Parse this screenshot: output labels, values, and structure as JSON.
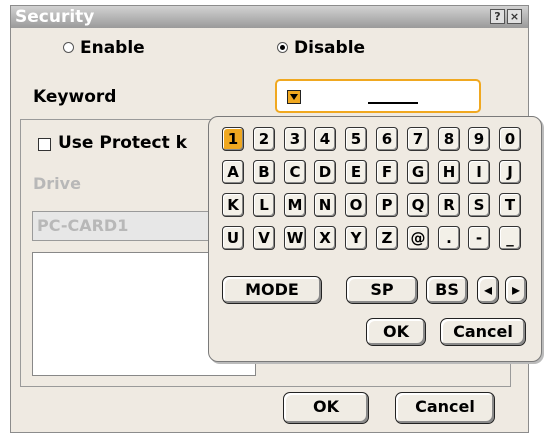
{
  "window": {
    "title": "Security",
    "help_glyph": "?",
    "close_glyph": "×"
  },
  "mode": {
    "enable_label": "Enable",
    "disable_label": "Disable",
    "selected": "Disable"
  },
  "keyword": {
    "label": "Keyword",
    "value": "",
    "accent_color": "#f0a820"
  },
  "protect": {
    "checkbox_label": "Use Protect key",
    "visible_label_fragment": "Use Protect k",
    "checked": false,
    "drive_label": "Drive",
    "drive_value": "PC-CARD1"
  },
  "dialog_buttons": {
    "ok": "OK",
    "cancel": "Cancel"
  },
  "keyboard": {
    "rows": [
      [
        "1",
        "2",
        "3",
        "4",
        "5",
        "6",
        "7",
        "8",
        "9",
        "0"
      ],
      [
        "A",
        "B",
        "C",
        "D",
        "E",
        "F",
        "G",
        "H",
        "I",
        "J"
      ],
      [
        "K",
        "L",
        "M",
        "N",
        "O",
        "P",
        "Q",
        "R",
        "S",
        "T"
      ],
      [
        "U",
        "V",
        "W",
        "X",
        "Y",
        "Z",
        "@",
        ".",
        "-",
        "_"
      ]
    ],
    "active_key": "1",
    "mode_label": "MODE",
    "space_label": "SP",
    "backspace_label": "BS",
    "left_arrow": "◂",
    "right_arrow": "▸",
    "ok": "OK",
    "cancel": "Cancel"
  }
}
